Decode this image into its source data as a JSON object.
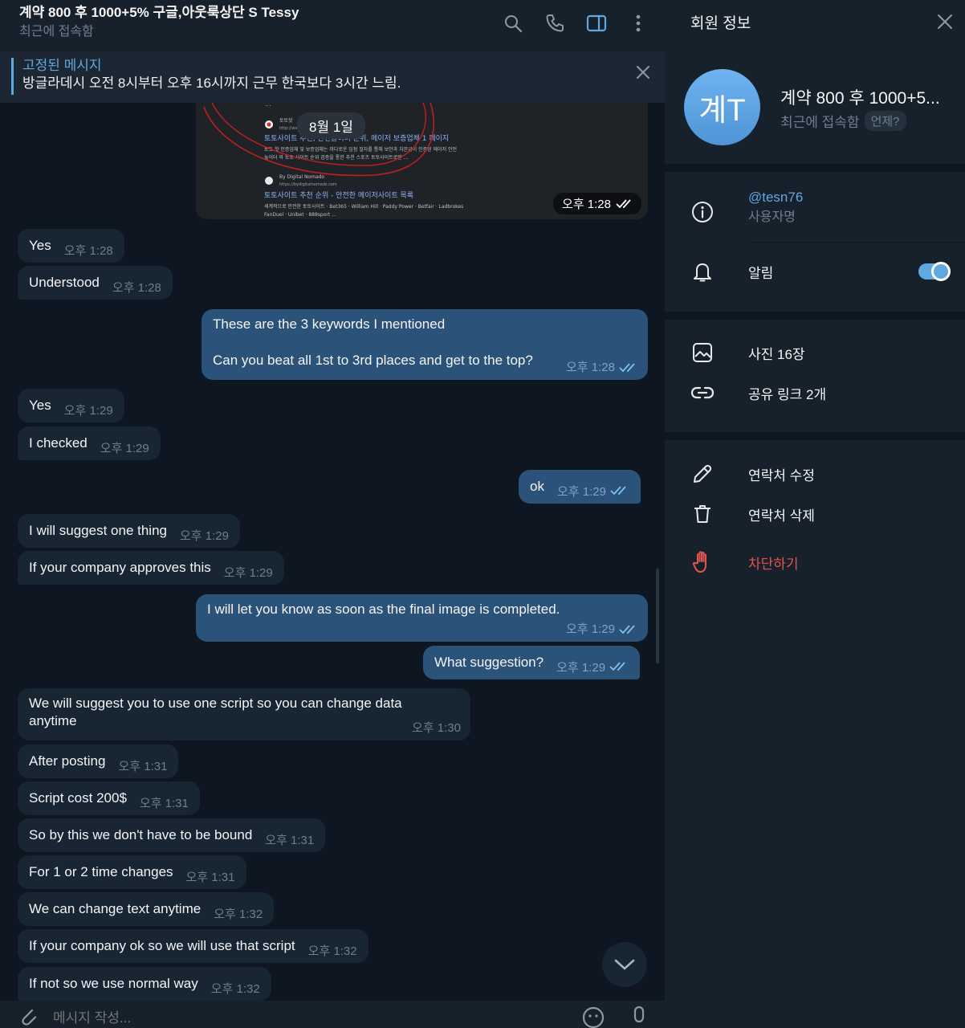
{
  "chat": {
    "title": "계약 800 후 1000+5% 구글,아웃룩상단 S Tessy",
    "status": "최근에 접속함"
  },
  "pinned": {
    "title": "고정된 메시지",
    "text": "방글라데시  오전 8시부터 오후 16시까지 근무 한국보다 3시간 느림."
  },
  "date_chip": "8월 1일",
  "image_message": {
    "time": "오후 1:28",
    "lines": [
      "토토사이트 추천, 안전놀이터 순위, 메이저 보증업체 1 페이지",
      "토토 핫 인증업체 및 보증업체는 까다로운 입점 절차를 통해 보안과 자본금이 인증된 메이저 안전",
      "놀이터 와 토토 사이트 순위 검증을 통한 추천 스포츠 토토사이트로만 ...",
      "By Digital Nomado",
      "https://bydigitalnomads.com",
      "토토사이트 추천 순위 - 안전한 메이저사이트 목록",
      "세계적으로 안전한 토토사이트 · Bet365 · William Hill · Paddy Power · Betfair · Ladbrokes",
      "FanDuel · Unibet · 888sport ..."
    ],
    "source_small": "토토핫",
    "source_url": "http://ww..."
  },
  "messages": [
    {
      "dir": "in",
      "text": "Yes",
      "time": "오후 1:28"
    },
    {
      "dir": "in",
      "text": "Understood",
      "time": "오후 1:28"
    },
    {
      "dir": "out",
      "line1": "These are the 3 keywords I mentioned",
      "line2": "Can you beat all 1st to 3rd places and get to the top?",
      "time": "오후 1:28"
    },
    {
      "dir": "in",
      "text": "Yes",
      "time": "오후 1:29"
    },
    {
      "dir": "in",
      "text": "I checked",
      "time": "오후 1:29"
    },
    {
      "dir": "out",
      "text": "ok",
      "time": "오후 1:29"
    },
    {
      "dir": "in",
      "text": "I will suggest one thing",
      "time": "오후 1:29"
    },
    {
      "dir": "in",
      "text": "If your company approves this",
      "time": "오후 1:29"
    },
    {
      "dir": "out",
      "text": "I will let you know as soon as the final image is completed.",
      "time": "오후 1:29"
    },
    {
      "dir": "out",
      "text": "What suggestion?",
      "time": "오후 1:29"
    },
    {
      "dir": "in",
      "text": "We will suggest you to use one script so you can change data anytime",
      "time": "오후 1:30"
    },
    {
      "dir": "in",
      "text": "After posting",
      "time": "오후 1:31"
    },
    {
      "dir": "in",
      "text": "Script cost 200$",
      "time": "오후 1:31"
    },
    {
      "dir": "in",
      "text": "So by this we don't have to be bound",
      "time": "오후 1:31"
    },
    {
      "dir": "in",
      "text": "For 1 or 2 time changes",
      "time": "오후 1:31"
    },
    {
      "dir": "in",
      "text": "We can change text anytime",
      "time": "오후 1:32"
    },
    {
      "dir": "in",
      "text": "If your company ok so we will use that script",
      "time": "오후 1:32"
    },
    {
      "dir": "in",
      "text": "If not so we use normal way",
      "time": "오후 1:32"
    }
  ],
  "composer": {
    "placeholder": "메시지 작성..."
  },
  "sidebar": {
    "header": "회원 정보",
    "avatar_initials": "계T",
    "name": "계약 800 후 1000+5...",
    "status": "최근에 접속함",
    "when_badge": "언제?",
    "username": "@tesn76",
    "username_label": "사용자명",
    "notifications_label": "알림",
    "notifications_on": true,
    "photos": "사진 16장",
    "links": "공유 링크 2개",
    "edit_contact": "연락처 수정",
    "delete_contact": "연락처 삭제",
    "block": "차단하기"
  },
  "colors": {
    "bg": "#0e1621",
    "panel": "#17212b",
    "incoming": "#182533",
    "outgoing": "#2b5278",
    "accent": "#5fa8e0",
    "danger": "#e5544f"
  },
  "icons": [
    "search-icon",
    "phone-icon",
    "sidebar-toggle-icon",
    "more-icon",
    "close-icon",
    "info-icon",
    "bell-icon",
    "photo-icon",
    "link-icon",
    "pencil-icon",
    "trash-icon",
    "hand-block-icon",
    "chevron-down-icon",
    "attach-icon",
    "emoji-icon",
    "mic-icon",
    "double-check-icon"
  ]
}
